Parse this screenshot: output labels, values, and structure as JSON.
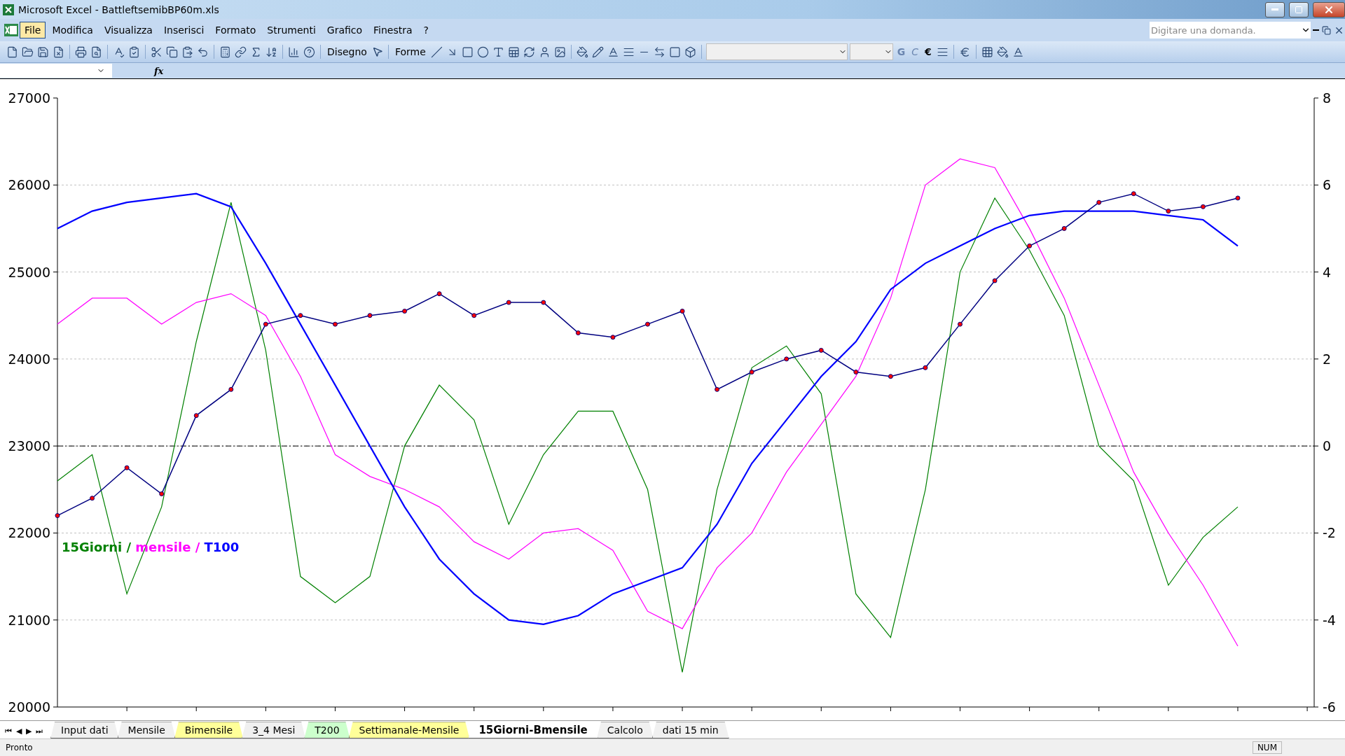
{
  "window": {
    "title": "Microsoft Excel - BattleftsemibBP60m.xls"
  },
  "menu": [
    {
      "label": "File",
      "selected": true
    },
    {
      "label": "Modifica",
      "selected": false
    },
    {
      "label": "Visualizza",
      "selected": false
    },
    {
      "label": "Inserisci",
      "selected": false
    },
    {
      "label": "Formato",
      "selected": false
    },
    {
      "label": "Strumenti",
      "selected": false
    },
    {
      "label": "Grafico",
      "selected": false
    },
    {
      "label": "Finestra",
      "selected": false
    },
    {
      "label": "?",
      "selected": false
    }
  ],
  "help_search": {
    "placeholder": "Digitare una domanda."
  },
  "drawing_toolbar": {
    "disegno": "Disegno",
    "forme": "Forme"
  },
  "format_toolbar": {
    "bold": "G",
    "italic": "C",
    "euro": "€"
  },
  "formula_bar": {
    "fx": "fx"
  },
  "chart_data": {
    "type": "line",
    "categories": [
      null,
      null,
      null,
      null,
      null,
      null,
      null,
      null,
      null,
      null,
      null,
      null,
      null,
      null,
      null,
      null,
      null,
      null,
      null,
      null,
      null,
      null,
      null,
      null,
      null,
      null,
      null,
      null,
      null,
      null,
      null,
      null,
      null,
      null,
      null
    ],
    "ylim": [
      20000,
      27000
    ],
    "grid": true,
    "ref_lines": [
      {
        "axis": "y",
        "value": 23000
      }
    ],
    "yticks": [
      {
        "value": 20000,
        "label": "20000"
      },
      {
        "value": 21000,
        "label": "21000"
      },
      {
        "value": 22000,
        "label": "22000"
      },
      {
        "value": 23000,
        "label": "23000"
      },
      {
        "value": 24000,
        "label": "24000"
      },
      {
        "value": 25000,
        "label": "25000"
      },
      {
        "value": 26000,
        "label": "26000"
      },
      {
        "value": 27000,
        "label": "27000"
      }
    ],
    "series": [
      {
        "name": "15Giorni",
        "color": "#008000",
        "values": [
          22600,
          22900,
          21300,
          22300,
          24200,
          25800,
          24100,
          21500,
          21200,
          21500,
          23000,
          23700,
          23300,
          22100,
          22900,
          23400,
          23400,
          22500,
          20400,
          22500,
          23900,
          24150,
          23600,
          21300,
          20800,
          22500,
          25000,
          25850,
          25250,
          24500,
          23000,
          22600,
          21400,
          21950,
          22300
        ]
      },
      {
        "name": "mensile",
        "color": "#ff00ff",
        "values": [
          24400,
          24700,
          24700,
          24400,
          24650,
          24750,
          24500,
          23800,
          22900,
          22650,
          22500,
          22300,
          21900,
          21700,
          22000,
          22050,
          21800,
          21100,
          20900,
          21600,
          22000,
          22700,
          23250,
          23800,
          24700,
          26000,
          26300,
          26200,
          25500,
          24700,
          23700,
          22700,
          22000,
          21400,
          20700
        ]
      },
      {
        "name": "T100",
        "color": "#0000ff",
        "values": [
          25500,
          25700,
          25800,
          25850,
          25900,
          25750,
          25100,
          24400,
          23700,
          23000,
          22300,
          21700,
          21300,
          21000,
          20950,
          21050,
          21300,
          21450,
          21600,
          22100,
          22800,
          23300,
          23800,
          24200,
          24800,
          25100,
          25300,
          25500,
          25650,
          25700,
          25700,
          25700,
          25650,
          25600,
          25300
        ]
      },
      {
        "color": "#000080",
        "marker": "circle",
        "values": [
          22200,
          22400,
          22750,
          22450,
          23350,
          23650,
          24400,
          24500,
          24400,
          24500,
          24550,
          24750,
          24500,
          24650,
          24650,
          24300,
          24250,
          24400,
          24550,
          23650,
          23850,
          24000,
          24100,
          23850,
          23800,
          23900,
          24400,
          24900,
          25300,
          25500,
          25800,
          25900,
          25700,
          25750,
          25850
        ]
      }
    ]
  },
  "chart_legend_separator": "/",
  "right_axis_labels": [
    "8",
    "6",
    "4",
    "2",
    "0",
    "-2",
    "-4",
    "-6"
  ],
  "sheet_nav": [
    "⏮",
    "◀",
    "▶",
    "⏭"
  ],
  "sheet_tabs": [
    {
      "label": "Input dati",
      "selected": false
    },
    {
      "label": "Mensile",
      "selected": false
    },
    {
      "label": "Bimensile",
      "selected": false,
      "color": "#ffff99"
    },
    {
      "label": "3_4 Mesi",
      "selected": false
    },
    {
      "label": "T200",
      "selected": false,
      "color": "#ccffcc"
    },
    {
      "label": "Settimanale-Mensile",
      "selected": false,
      "color": "#ffff99"
    },
    {
      "label": "15Giorni-Bmensile",
      "selected": true
    },
    {
      "label": "Calcolo",
      "selected": false
    },
    {
      "label": "dati 15 min",
      "selected": false
    }
  ],
  "status_bar": {
    "status": "Pronto",
    "num": "NUM"
  }
}
